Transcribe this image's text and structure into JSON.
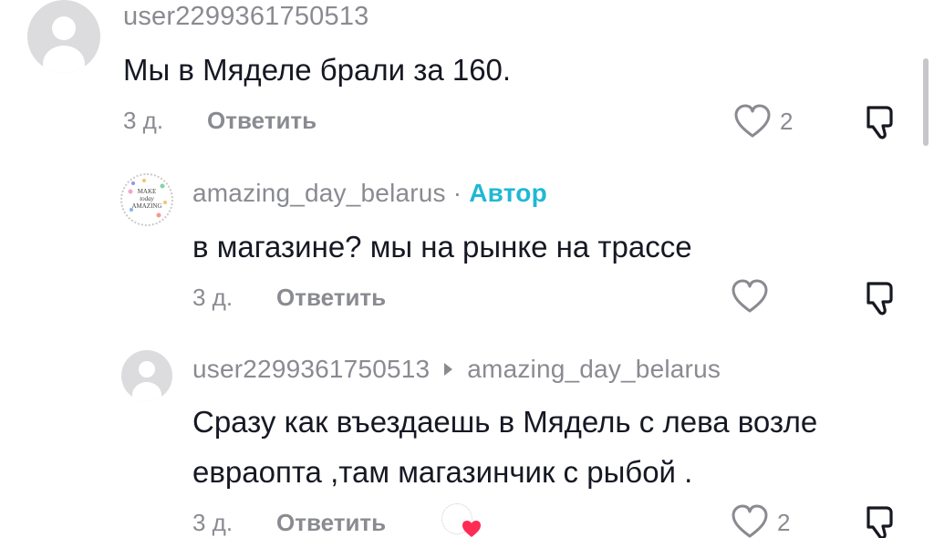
{
  "comments": [
    {
      "username": "user2299361750513",
      "text": "Мы в Мяделе брали за 160.",
      "age": "3 д.",
      "reply_label": "Ответить",
      "likes": "2"
    },
    {
      "username": "amazing_day_belarus",
      "separator": "·",
      "author_tag": "Автор",
      "text": "в магазине? мы на рынке на трассе",
      "age": "3 д.",
      "reply_label": "Ответить",
      "avatar_lines": [
        "MAKE",
        "today",
        "AMAZING"
      ]
    },
    {
      "username": "user2299361750513",
      "reply_to": "amazing_day_belarus",
      "text_line1": "Сразу как въездаешь в Мядель с лева возле",
      "text_line2": "евраопта ,там магазинчик с рыбой .",
      "age": "3 д.",
      "reply_label": "Ответить",
      "likes": "2",
      "liked_by_author": true
    }
  ],
  "icons": {
    "avatar": "default-user-avatar",
    "like": "heart-outline-icon",
    "dislike": "thumbs-down-icon",
    "reply_arrow": "triangle-right-icon",
    "creator_liked": "creator-liked-heart-icon"
  },
  "colors": {
    "text": "#161823",
    "muted": "#8a8b91",
    "author": "#20b8d5",
    "heart": "#fe2c55"
  }
}
